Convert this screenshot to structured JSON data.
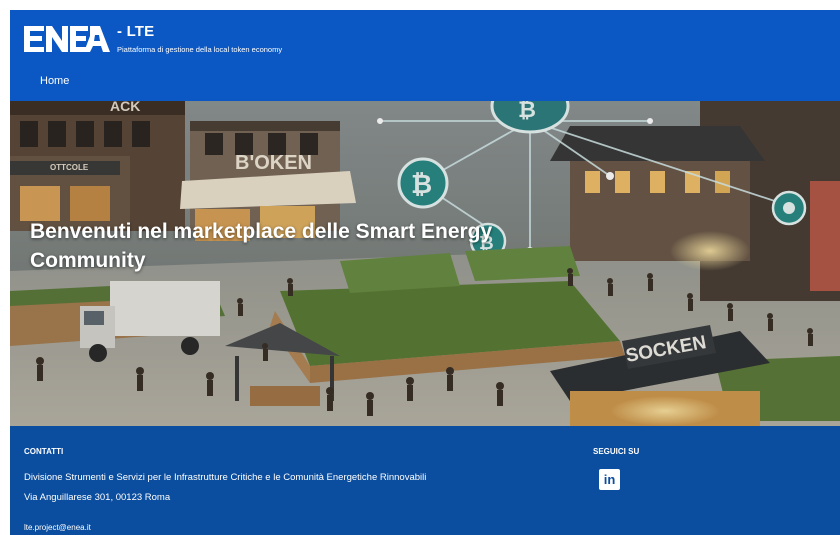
{
  "header": {
    "logo_text": "ENEA",
    "app_title": "- LTE",
    "app_subtitle": "Piattaforma di gestione della local token economy",
    "nav": {
      "home": "Home"
    }
  },
  "hero": {
    "title": "Benvenuti nel marketplace delle Smart Energy Community",
    "sign_token": "B'OKEN",
    "sign_left": "ACK",
    "sign_cafe": "OTTCOLE",
    "sign_right": "SOCKEN",
    "coin_symbol": "₿"
  },
  "footer": {
    "contacts_heading": "CONTATTI",
    "address_line1": "Divisione Strumenti e Servizi per le Infrastrutture Critiche e le Comunità Energetiche Rinnovabili",
    "address_line2": "Via Anguillarese 301, 00123 Roma",
    "email": "lte.project@enea.it",
    "follow_heading": "SEGUICI SU",
    "linkedin_label": "in"
  },
  "colors": {
    "header_bg": "#0b58c4",
    "footer_bg": "#0b4d9e",
    "coin_teal": "#2a8a86"
  }
}
